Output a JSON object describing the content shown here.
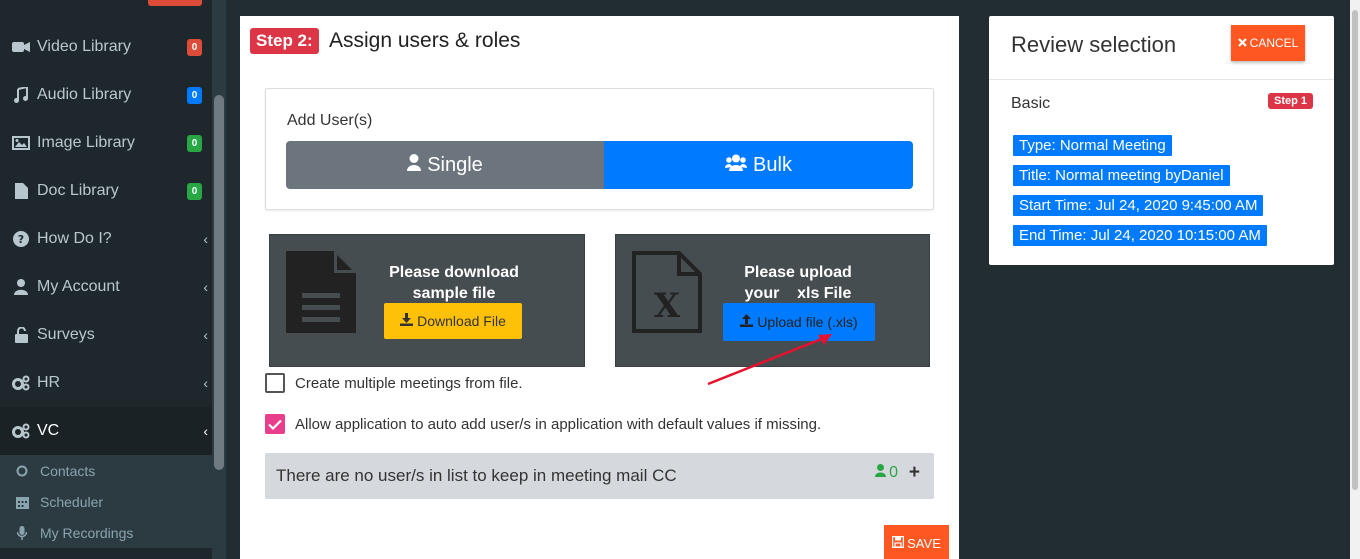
{
  "sidebar": {
    "items": [
      {
        "label": "Video Library",
        "badge": "0",
        "badge_color": "#dd4b39",
        "icon": "video-icon"
      },
      {
        "label": "Audio Library",
        "badge": "0",
        "badge_color": "#007bff",
        "icon": "music-icon"
      },
      {
        "label": "Image Library",
        "badge": "0",
        "badge_color": "#28a745",
        "icon": "image-icon"
      },
      {
        "label": "Doc Library",
        "badge": "0",
        "badge_color": "#28a745",
        "icon": "file-icon"
      },
      {
        "label": "How Do I?",
        "icon": "question-circle-icon"
      },
      {
        "label": "My Account",
        "icon": "user-icon"
      },
      {
        "label": "Surveys",
        "icon": "unlock-icon"
      },
      {
        "label": "HR",
        "icon": "cogs-icon"
      },
      {
        "label": "VC",
        "icon": "cogs-icon"
      }
    ],
    "sub_items": [
      {
        "label": "Contacts",
        "icon": "circle-icon"
      },
      {
        "label": "Scheduler",
        "icon": "calendar-icon"
      },
      {
        "label": "My Recordings",
        "icon": "microphone-icon"
      }
    ]
  },
  "main": {
    "step_tag": "Step 2:",
    "step_title": "Assign users & roles",
    "add_users_label": "Add User(s)",
    "single_label": "Single",
    "bulk_label": "Bulk",
    "download_text_1": "Please download",
    "download_text_2": "sample file",
    "download_button": "Download File",
    "upload_text_1": "Please upload",
    "upload_text_2": "your    xls File",
    "upload_button": "Upload file (.xls)",
    "checkbox_multiple": "Create multiple meetings from file.",
    "checkbox_auto_add": "Allow application to auto add user/s in application with default values if missing.",
    "cc_text": "There are no user/s in list to keep in meeting mail CC",
    "cc_count": "0",
    "save_label": "SAVE"
  },
  "review": {
    "title": "Review selection",
    "cancel_label": "CANCEL",
    "section": "Basic",
    "step_badge": "Step 1",
    "chips": [
      "Type: Normal Meeting",
      "Title: Normal meeting byDaniel",
      "Start Time: Jul 24, 2020 9:45:00 AM",
      "End Time: Jul 24, 2020 10:15:00 AM"
    ]
  }
}
